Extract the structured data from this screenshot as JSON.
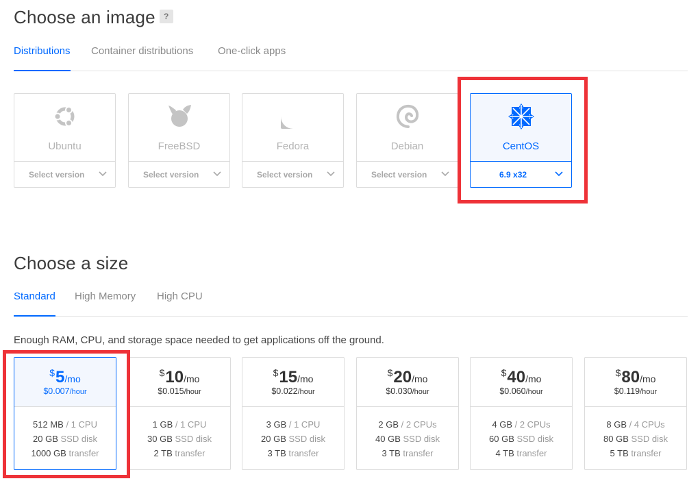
{
  "image_section": {
    "title": "Choose an image",
    "help": "?",
    "tabs": [
      {
        "label": "Distributions",
        "active": true
      },
      {
        "label": "Container distributions",
        "active": false
      },
      {
        "label": "One-click apps",
        "active": false
      }
    ],
    "distros": [
      {
        "name": "Ubuntu",
        "icon": "ubuntu-logo-icon",
        "version": "Select version",
        "selected": false
      },
      {
        "name": "FreeBSD",
        "icon": "freebsd-logo-icon",
        "version": "Select version",
        "selected": false
      },
      {
        "name": "Fedora",
        "icon": "fedora-logo-icon",
        "version": "Select version",
        "selected": false
      },
      {
        "name": "Debian",
        "icon": "debian-logo-icon",
        "version": "Select version",
        "selected": false
      },
      {
        "name": "CentOS",
        "icon": "centos-logo-icon",
        "version": "6.9 x32",
        "selected": true
      }
    ]
  },
  "size_section": {
    "title": "Choose a size",
    "tabs": [
      {
        "label": "Standard",
        "active": true
      },
      {
        "label": "High Memory",
        "active": false
      },
      {
        "label": "High CPU",
        "active": false
      }
    ],
    "description": "Enough RAM, CPU, and storage space needed to get applications off the ground.",
    "plans": [
      {
        "currency": "$",
        "price": "5",
        "period": "/mo",
        "hourly": "$0.007",
        "hourly_unit": "/hour",
        "ram": "512 MB",
        "cpu": "/ 1 CPU",
        "disk": "20 GB",
        "disk_label": "SSD disk",
        "transfer": "1000 GB",
        "transfer_label": "transfer",
        "selected": true
      },
      {
        "currency": "$",
        "price": "10",
        "period": "/mo",
        "hourly": "$0.015",
        "hourly_unit": "/hour",
        "ram": "1 GB",
        "cpu": "/ 1 CPU",
        "disk": "30 GB",
        "disk_label": "SSD disk",
        "transfer": "2 TB",
        "transfer_label": "transfer",
        "selected": false
      },
      {
        "currency": "$",
        "price": "15",
        "period": "/mo",
        "hourly": "$0.022",
        "hourly_unit": "/hour",
        "ram": "3 GB",
        "cpu": "/ 1 CPU",
        "disk": "20 GB",
        "disk_label": "SSD disk",
        "transfer": "3 TB",
        "transfer_label": "transfer",
        "selected": false
      },
      {
        "currency": "$",
        "price": "20",
        "period": "/mo",
        "hourly": "$0.030",
        "hourly_unit": "/hour",
        "ram": "2 GB",
        "cpu": "/ 2 CPUs",
        "disk": "40 GB",
        "disk_label": "SSD disk",
        "transfer": "3 TB",
        "transfer_label": "transfer",
        "selected": false
      },
      {
        "currency": "$",
        "price": "40",
        "period": "/mo",
        "hourly": "$0.060",
        "hourly_unit": "/hour",
        "ram": "4 GB",
        "cpu": "/ 2 CPUs",
        "disk": "60 GB",
        "disk_label": "SSD disk",
        "transfer": "4 TB",
        "transfer_label": "transfer",
        "selected": false
      },
      {
        "currency": "$",
        "price": "80",
        "period": "/mo",
        "hourly": "$0.119",
        "hourly_unit": "/hour",
        "ram": "8 GB",
        "cpu": "/ 4 CPUs",
        "disk": "80 GB",
        "disk_label": "SSD disk",
        "transfer": "5 TB",
        "transfer_label": "transfer",
        "selected": false
      }
    ]
  },
  "colors": {
    "accent": "#0069ff",
    "highlight": "#ee3238",
    "muted": "#b3b3b3"
  }
}
